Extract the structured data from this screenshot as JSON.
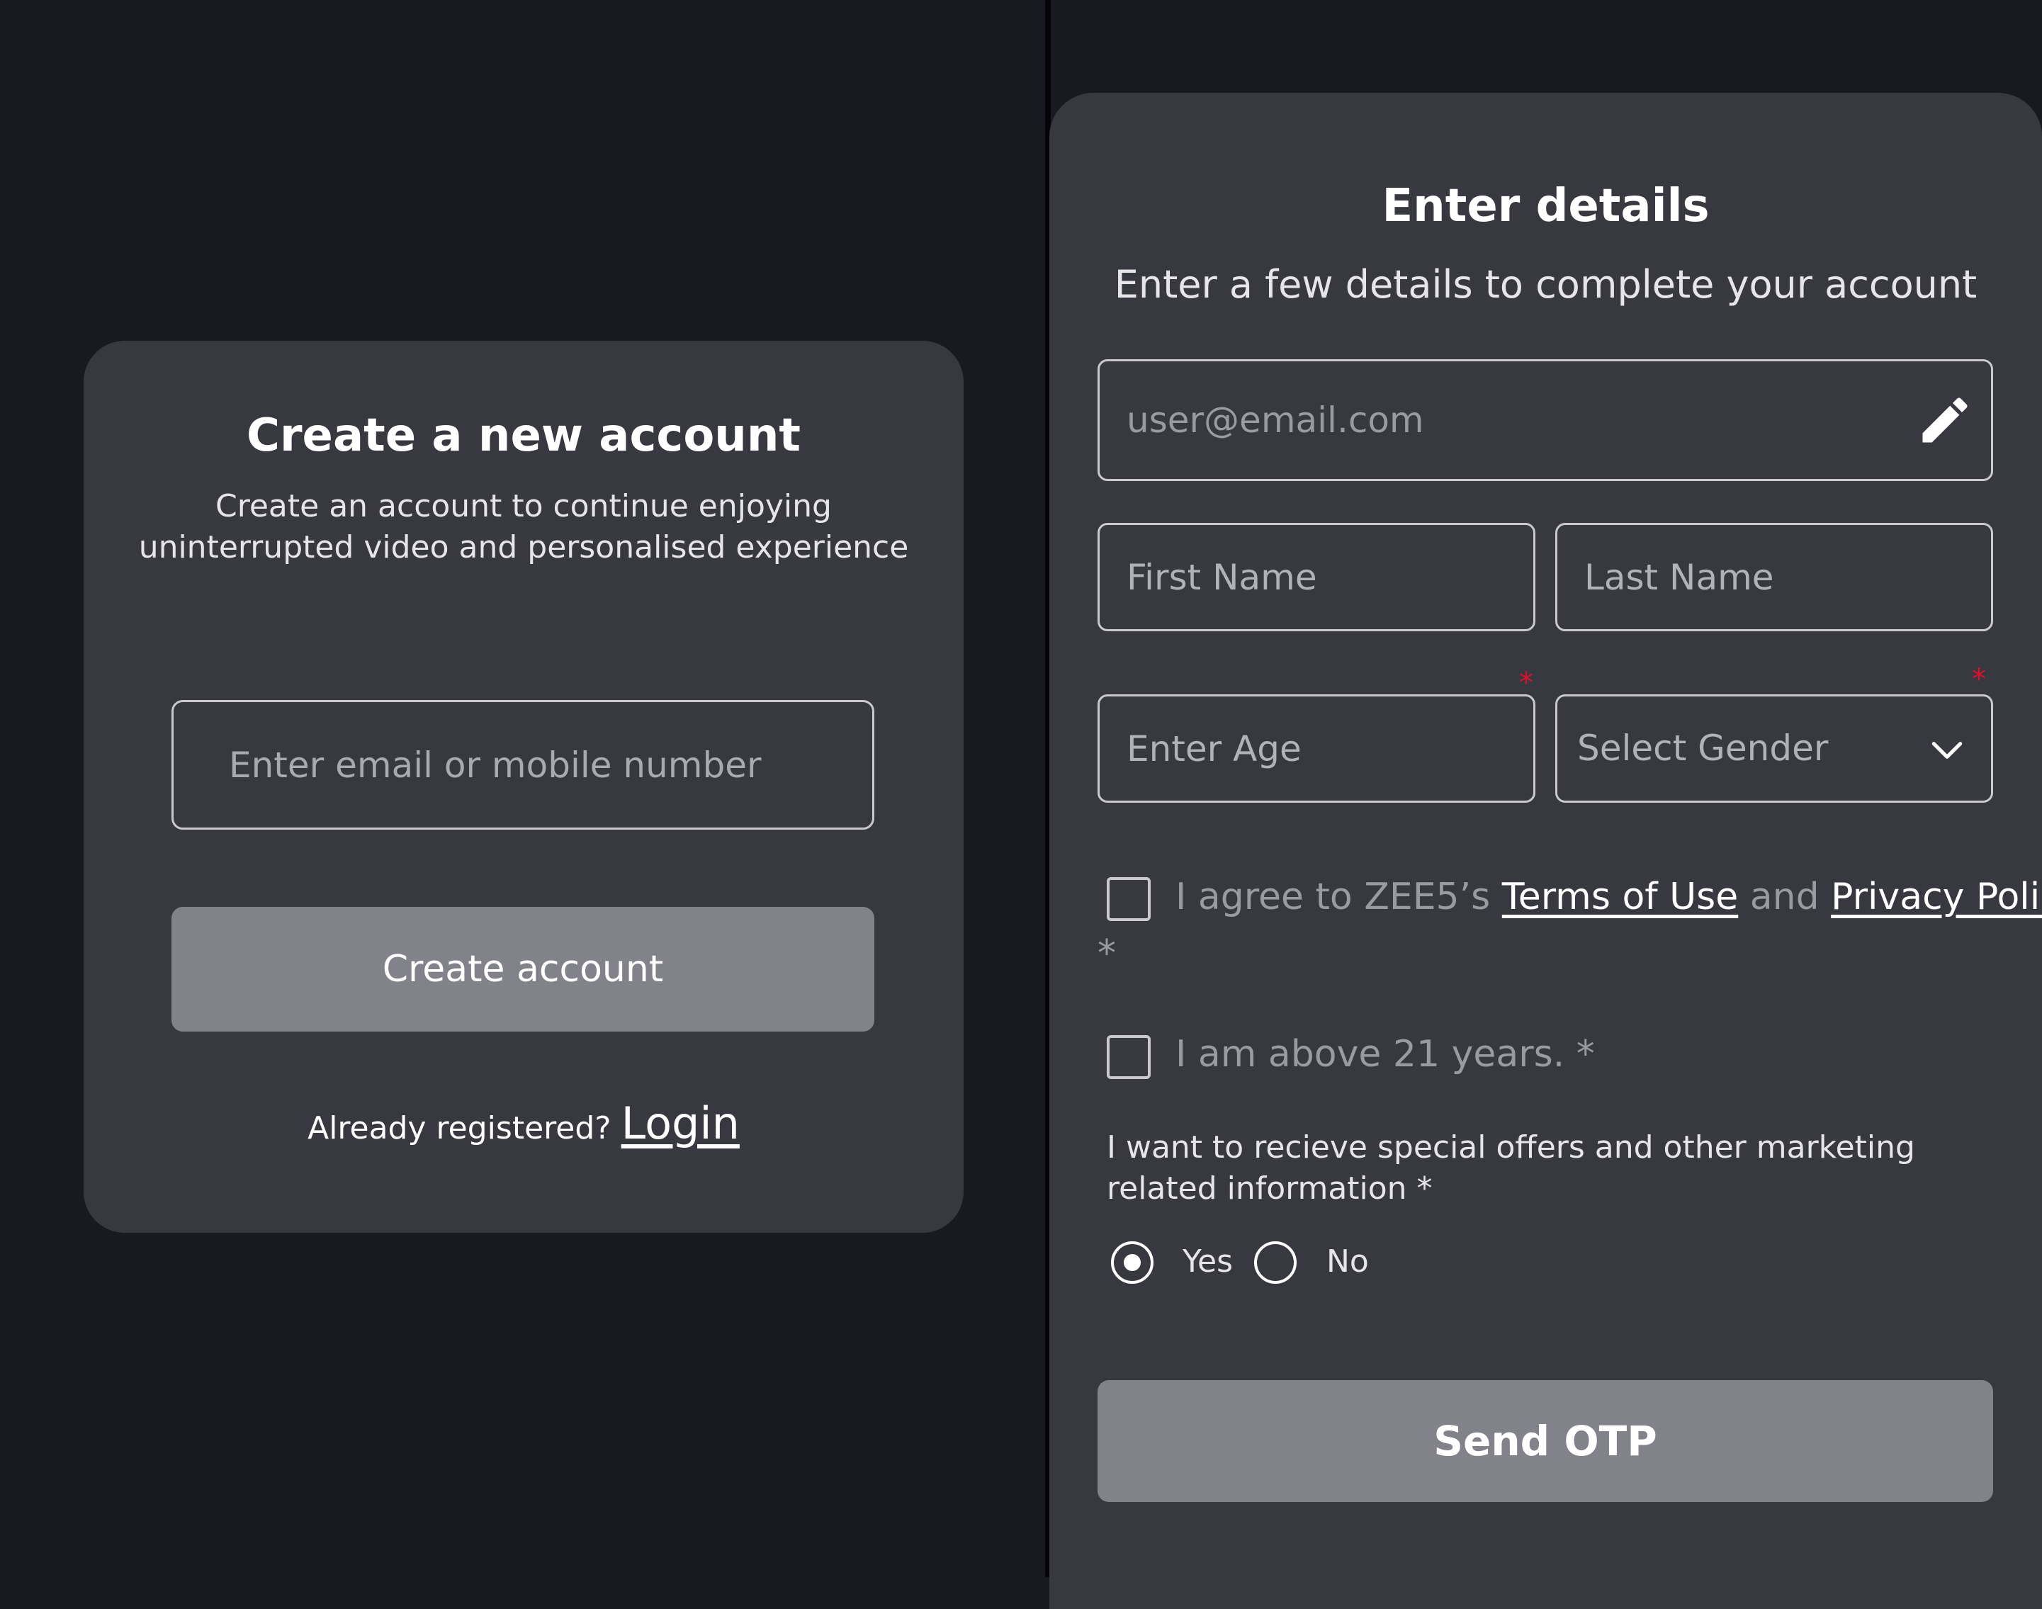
{
  "create_account": {
    "title": "Create a new account",
    "subtitle": "Create an account to continue enjoying uninterrupted video and personalised experience",
    "input_placeholder": "Enter email or mobile number",
    "create_button": "Create account",
    "already_registered": "Already registered?",
    "login_link": "Login"
  },
  "enter_details": {
    "title": "Enter details",
    "subtitle": "Enter a few details to complete your account",
    "email_value": "user@email.com",
    "edit_icon": "pencil-icon",
    "first_name_placeholder": "First Name",
    "last_name_placeholder": "Last Name",
    "age_placeholder": "Enter Age",
    "gender_placeholder": "Select Gender",
    "required_mark": "*",
    "terms": {
      "prefix": "I agree to ZEE5’s ",
      "terms_link": "Terms of Use",
      "and": " and ",
      "privacy_link": "Privacy Policy",
      "star": "*",
      "checked": false
    },
    "age_check": {
      "label": "I am above 21 years. *",
      "checked": false
    },
    "marketing": {
      "question": "I want to recieve special offers and other marketing related information *",
      "options": [
        "Yes",
        "No"
      ],
      "selected": "Yes"
    },
    "send_button": "Send OTP"
  },
  "colors": {
    "background": "#191922",
    "card": "#383841",
    "button": "#82828b",
    "required": "#e0102b"
  }
}
